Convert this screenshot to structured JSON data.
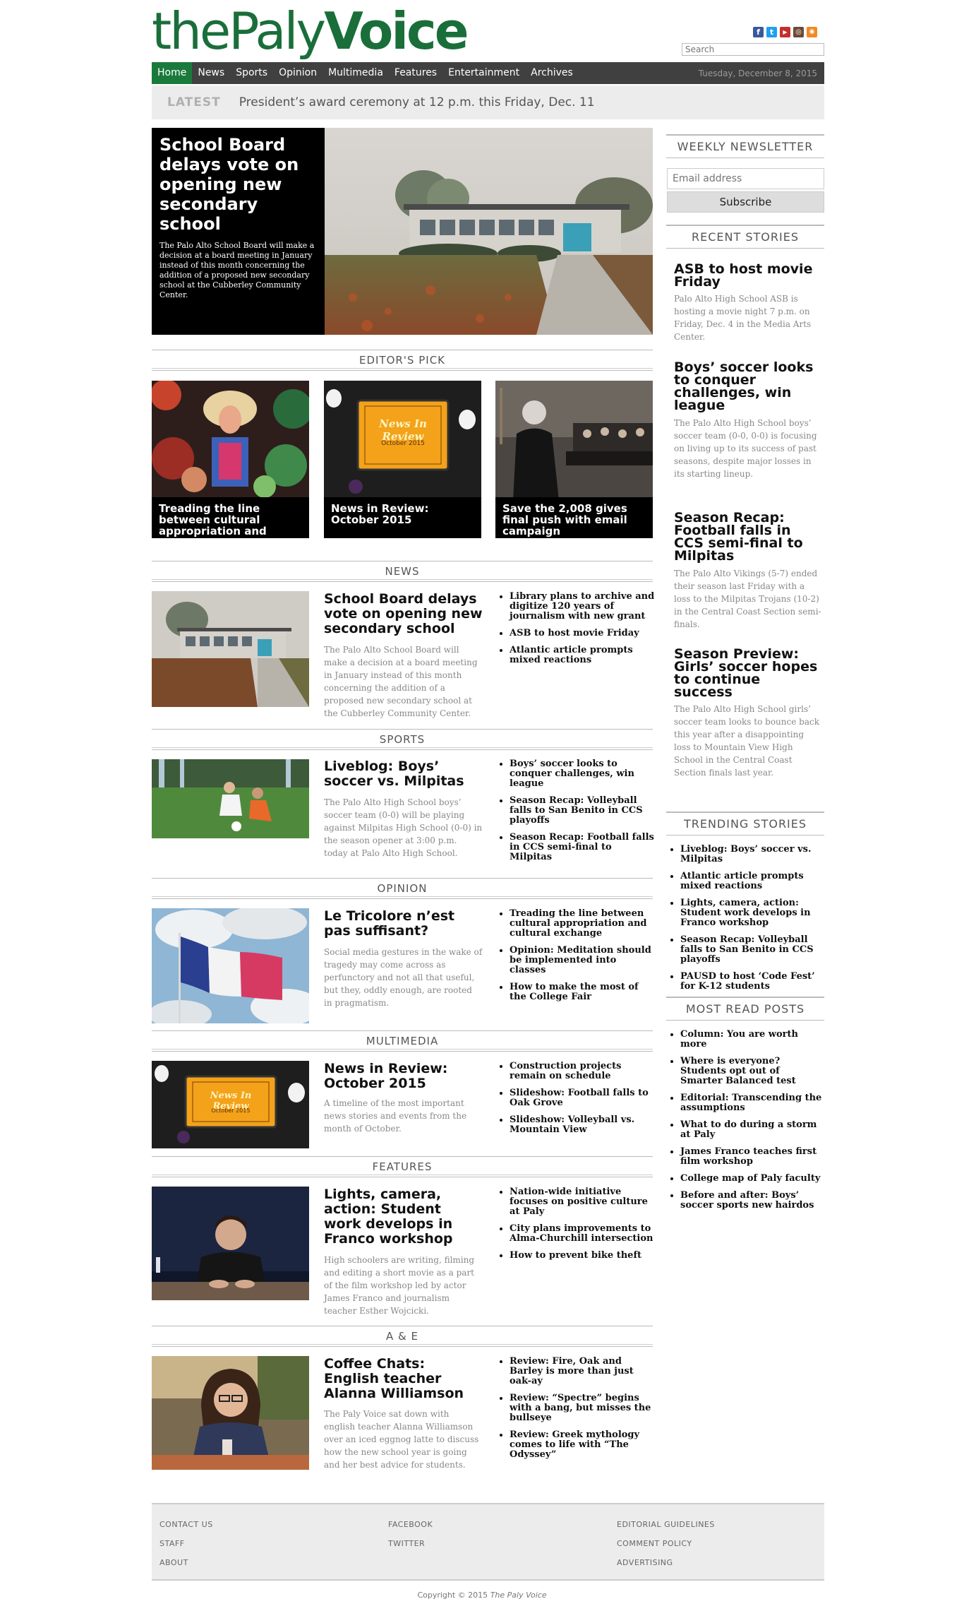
{
  "header": {
    "logo_thin": "thePaly",
    "logo_bold": "Voice",
    "search_placeholder": "Search",
    "social_icons": [
      "facebook-icon",
      "twitter-icon",
      "youtube-icon",
      "instagram-icon",
      "rss-icon"
    ]
  },
  "nav": {
    "items": [
      "Home",
      "News",
      "Sports",
      "Opinion",
      "Multimedia",
      "Features",
      "Entertainment",
      "Archives"
    ],
    "date": "Tuesday, December 8, 2015"
  },
  "latest": {
    "label": "LATEST",
    "text": "President’s award ceremony at 12 p.m. this Friday, Dec. 11"
  },
  "hero": {
    "title": "School Board delays vote on opening new secondary school",
    "dek": "The Palo Alto School Board will make a decision at a board meeting in January instead of this month concerning the addition of a proposed new secondary school at the Cubberley Community Center."
  },
  "editors_pick": {
    "heading": "EDITOR'S PICK",
    "items": [
      {
        "caption": "Treading the line between cultural appropriation and"
      },
      {
        "caption": "News in Review: October 2015",
        "badge_title": "News In Review",
        "badge_sub": "October 2015"
      },
      {
        "caption": "Save the 2,008 gives final push with email campaign"
      }
    ]
  },
  "sections": [
    {
      "heading": "NEWS",
      "title": "School Board delays vote on opening new secondary school",
      "dek": "The Palo Alto School Board will make a decision at a board meeting in January instead of this month concerning the addition of a proposed new secondary school at the Cubberley Community Center.",
      "links": [
        "Library plans to archive and digitize 120 years of journalism with new grant",
        "ASB to host movie Friday",
        "Atlantic article prompts mixed reactions"
      ]
    },
    {
      "heading": "SPORTS",
      "title": "Liveblog: Boys’ soccer vs. Milpitas",
      "dek": "The Palo Alto High School boys’ soccer team (0-0) will be playing against Milpitas High School (0-0) in the season opener at 3:00 p.m. today at Palo Alto High School.",
      "links": [
        "Boys’ soccer looks to conquer challenges, win league",
        "Season Recap: Volleyball falls to San Benito in CCS playoffs",
        "Season Recap: Football falls in CCS semi-final to Milpitas"
      ]
    },
    {
      "heading": "OPINION",
      "title": "Le Tricolore n’est pas suffisant?",
      "dek": "Social media gestures in the wake of tragedy may come across as perfunctory and not all that useful, but they, oddly enough, are rooted in pragmatism.",
      "links": [
        "Treading the line between cultural appropriation and cultural exchange",
        "Opinion: Meditation should be implemented into classes",
        "How to make the most of the College Fair"
      ]
    },
    {
      "heading": "MULTIMEDIA",
      "title": "News in Review: October 2015",
      "dek": "A timeline of the most important news stories and events from the month of October.",
      "links": [
        "Construction projects remain on schedule",
        "Slideshow: Football falls to Oak Grove",
        "Slideshow: Volleyball vs. Mountain View"
      ]
    },
    {
      "heading": "FEATURES",
      "title": "Lights, camera, action: Student work develops in Franco workshop",
      "dek": "High schoolers are writing, filming and editing a short movie as a part of the film workshop led by actor James Franco and journalism teacher Esther Wojcicki.",
      "links": [
        "Nation-wide initiative focuses on positive culture at Paly",
        "City plans improvements to Alma-Churchill intersection",
        "How to prevent bike theft"
      ]
    },
    {
      "heading": "A & E",
      "title": "Coffee Chats: English teacher Alanna Williamson",
      "dek": "The Paly Voice sat down with english teacher Alanna Williamson over an iced eggnog latte to discuss how the new school year is going and her best advice for students.",
      "links": [
        "Review: Fire, Oak and Barley is more than just oak-ay",
        "Review: “Spectre” begins with a bang, but misses the bullseye",
        "Review: Greek mythology comes to life with “The Odyssey”"
      ]
    }
  ],
  "sidebar": {
    "newsletter_heading": "WEEKLY NEWSLETTER",
    "email_placeholder": "Email address",
    "subscribe_label": "Subscribe",
    "recent_heading": "RECENT STORIES",
    "recent": [
      {
        "title": "ASB to host movie Friday",
        "dek": "Palo Alto High School ASB is hosting a movie night 7 p.m. on Friday, Dec. 4 in the Media Arts Center."
      },
      {
        "title": "Boys’ soccer looks to conquer challenges, win league",
        "dek": "The Palo Alto High School boys’ soccer team (0-0, 0-0) is focusing on living up to its success of past seasons, despite major losses in its starting lineup."
      },
      {
        "title": "Season Recap: Football falls in CCS semi-final to Milpitas",
        "dek": "The Palo Alto Vikings (5-7) ended their season last Friday with a loss to the Milpitas Trojans (10-2) in the Central Coast Section semi-finals."
      },
      {
        "title": "Season Preview: Girls’ soccer hopes to continue success",
        "dek": "The Palo Alto High School girls’ soccer team looks to bounce back this year after a disappointing loss to Mountain View High School in the Central Coast Section finals last year."
      }
    ],
    "trending_heading": "TRENDING STORIES",
    "trending": [
      "Liveblog: Boys’ soccer vs. Milpitas",
      "Atlantic article prompts mixed reactions",
      "Lights, camera, action: Student work develops in Franco workshop",
      "Season Recap: Volleyball falls to San Benito in CCS playoffs",
      "PAUSD to host ‘Code Fest’ for K-12 students"
    ],
    "mostread_heading": "MOST READ POSTS",
    "mostread": [
      "Column: You are worth more",
      "Where is everyone? Students opt out of Smarter Balanced test",
      "Editorial: Transcending the assumptions",
      "What to do during a storm at Paly",
      "James Franco teaches first film workshop",
      "College map of Paly faculty",
      "Before and after: Boys’ soccer sports new hairdos"
    ]
  },
  "footer": {
    "links": [
      "CONTACT US",
      "STAFF",
      "ABOUT",
      "FACEBOOK",
      "TWITTER",
      "EDITORIAL GUIDELINES",
      "COMMENT POLICY",
      "ADVERTISING"
    ],
    "copyright_prefix": "Copyright © 2015",
    "copyright_name": "The Paly Voice"
  },
  "colors": {
    "brand_green": "#1a6e3a",
    "nav_bg": "#404040",
    "nav_active": "#1a7a3c"
  }
}
